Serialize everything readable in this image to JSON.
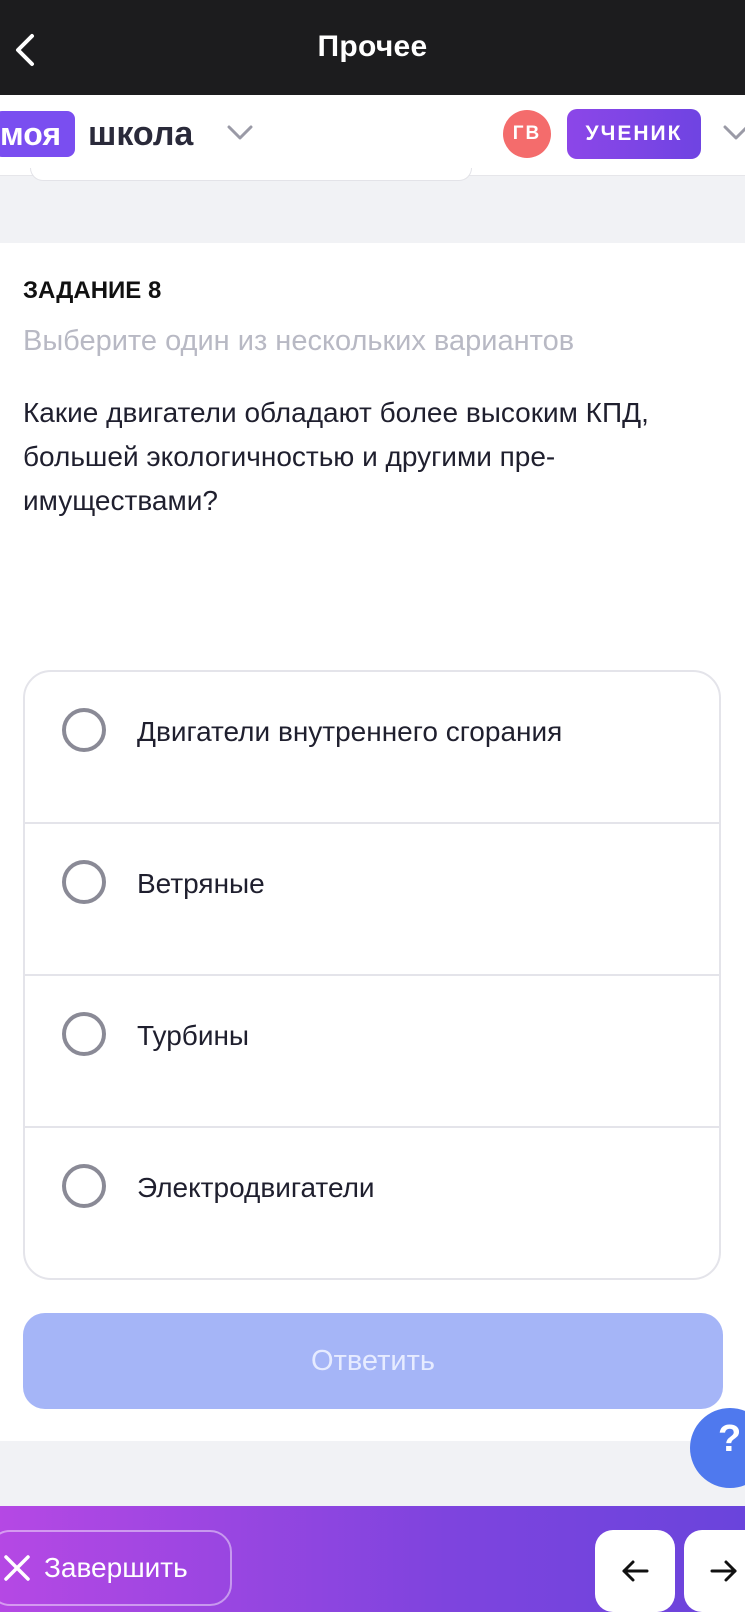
{
  "topbar": {
    "title": "Прочее",
    "back_icon": "chevron-left-icon"
  },
  "appbar": {
    "logo_part1": "моя",
    "logo_part2": "школа",
    "avatar_initials": "ГВ",
    "role_label": "УЧЕНИК",
    "avatar_color": "#f46c6c",
    "brand_color": "#7a4ef0"
  },
  "task": {
    "label": "ЗАДАНИЕ 8",
    "hint": "Выберите один из нескольких вариантов",
    "question": "Какие двигатели обладают более высоким КПД, большей экологичностью и другими пре-имуществами?",
    "options": [
      {
        "label": "Двигатели внутреннего сгорания",
        "selected": false
      },
      {
        "label": "Ветряные",
        "selected": false
      },
      {
        "label": "Турбины",
        "selected": false
      },
      {
        "label": "Электродвигатели",
        "selected": false
      }
    ],
    "submit_label": "Ответить"
  },
  "help": {
    "label": "?"
  },
  "bottombar": {
    "finish_label": "Завершить",
    "prev_icon": "arrow-left-icon",
    "next_icon": "arrow-right-icon"
  }
}
